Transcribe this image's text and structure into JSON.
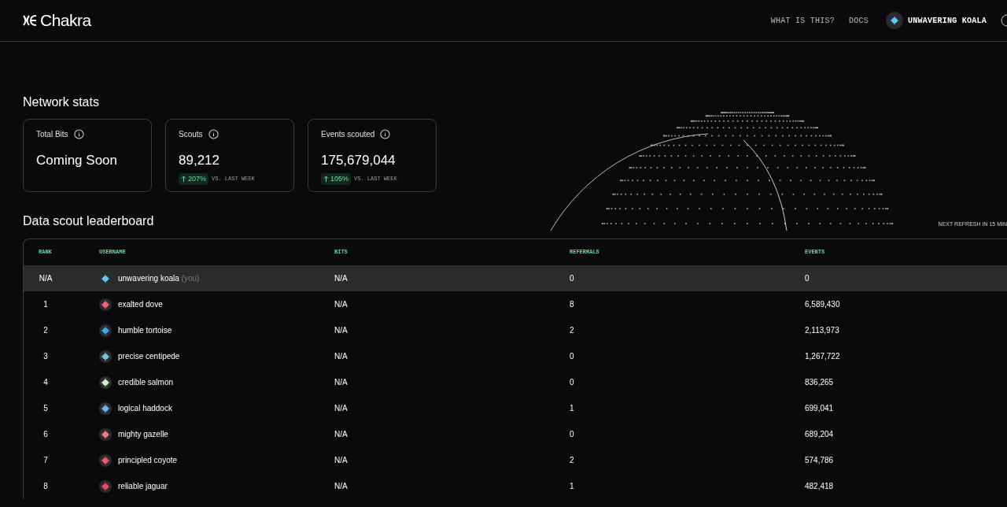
{
  "header": {
    "logo": "Chakra",
    "nav": [
      "WHAT IS THIS?",
      "DOCS"
    ],
    "user": {
      "name": "UNWAVERING KOALA",
      "color": "#5ec8f0"
    }
  },
  "network_stats": {
    "title": "Network stats",
    "cards": [
      {
        "label": "Total Bits",
        "value": "Coming Soon"
      },
      {
        "label": "Scouts",
        "value": "89,212",
        "change": "207%",
        "change_label": "VS. LAST WEEK"
      },
      {
        "label": "Events scouted",
        "value": "175,679,044",
        "change": "105%",
        "change_label": "VS. LAST WEEK"
      }
    ]
  },
  "leaderboard": {
    "title": "Data scout leaderboard",
    "refresh": "NEXT REFRESH IN 15 MIN",
    "columns": [
      "RANK",
      "USERNAME",
      "BITS",
      "REFERRALS",
      "EVENTS"
    ],
    "rows": [
      {
        "rank": "N/A",
        "username": "unwavering koala",
        "suffix": "(you)",
        "bits": "N/A",
        "referrals": "0",
        "events": "0",
        "color": "#5ec8f0",
        "selected": true
      },
      {
        "rank": "1",
        "username": "exalted dove",
        "bits": "N/A",
        "referrals": "8",
        "events": "6,589,430",
        "color": "#f0607a",
        "selected": false
      },
      {
        "rank": "2",
        "username": "humble tortoise",
        "bits": "N/A",
        "referrals": "2",
        "events": "2,113,973",
        "color": "#3aa8e8",
        "selected": false
      },
      {
        "rank": "3",
        "username": "precise centipede",
        "bits": "N/A",
        "referrals": "0",
        "events": "1,267,722",
        "color": "#6cc8d8",
        "selected": false
      },
      {
        "rank": "4",
        "username": "credible salmon",
        "bits": "N/A",
        "referrals": "0",
        "events": "836,265",
        "color": "#c8f0c0",
        "selected": false
      },
      {
        "rank": "5",
        "username": "logical haddock",
        "bits": "N/A",
        "referrals": "1",
        "events": "699,041",
        "color": "#60b8f8",
        "selected": false
      },
      {
        "rank": "6",
        "username": "mighty gazelle",
        "bits": "N/A",
        "referrals": "0",
        "events": "689,204",
        "color": "#f87878",
        "selected": false
      },
      {
        "rank": "7",
        "username": "principled coyote",
        "bits": "N/A",
        "referrals": "2",
        "events": "574,786",
        "color": "#f05868",
        "selected": false
      },
      {
        "rank": "8",
        "username": "reliable jaguar",
        "bits": "N/A",
        "referrals": "1",
        "events": "482,418",
        "color": "#f04860",
        "selected": false
      }
    ]
  }
}
